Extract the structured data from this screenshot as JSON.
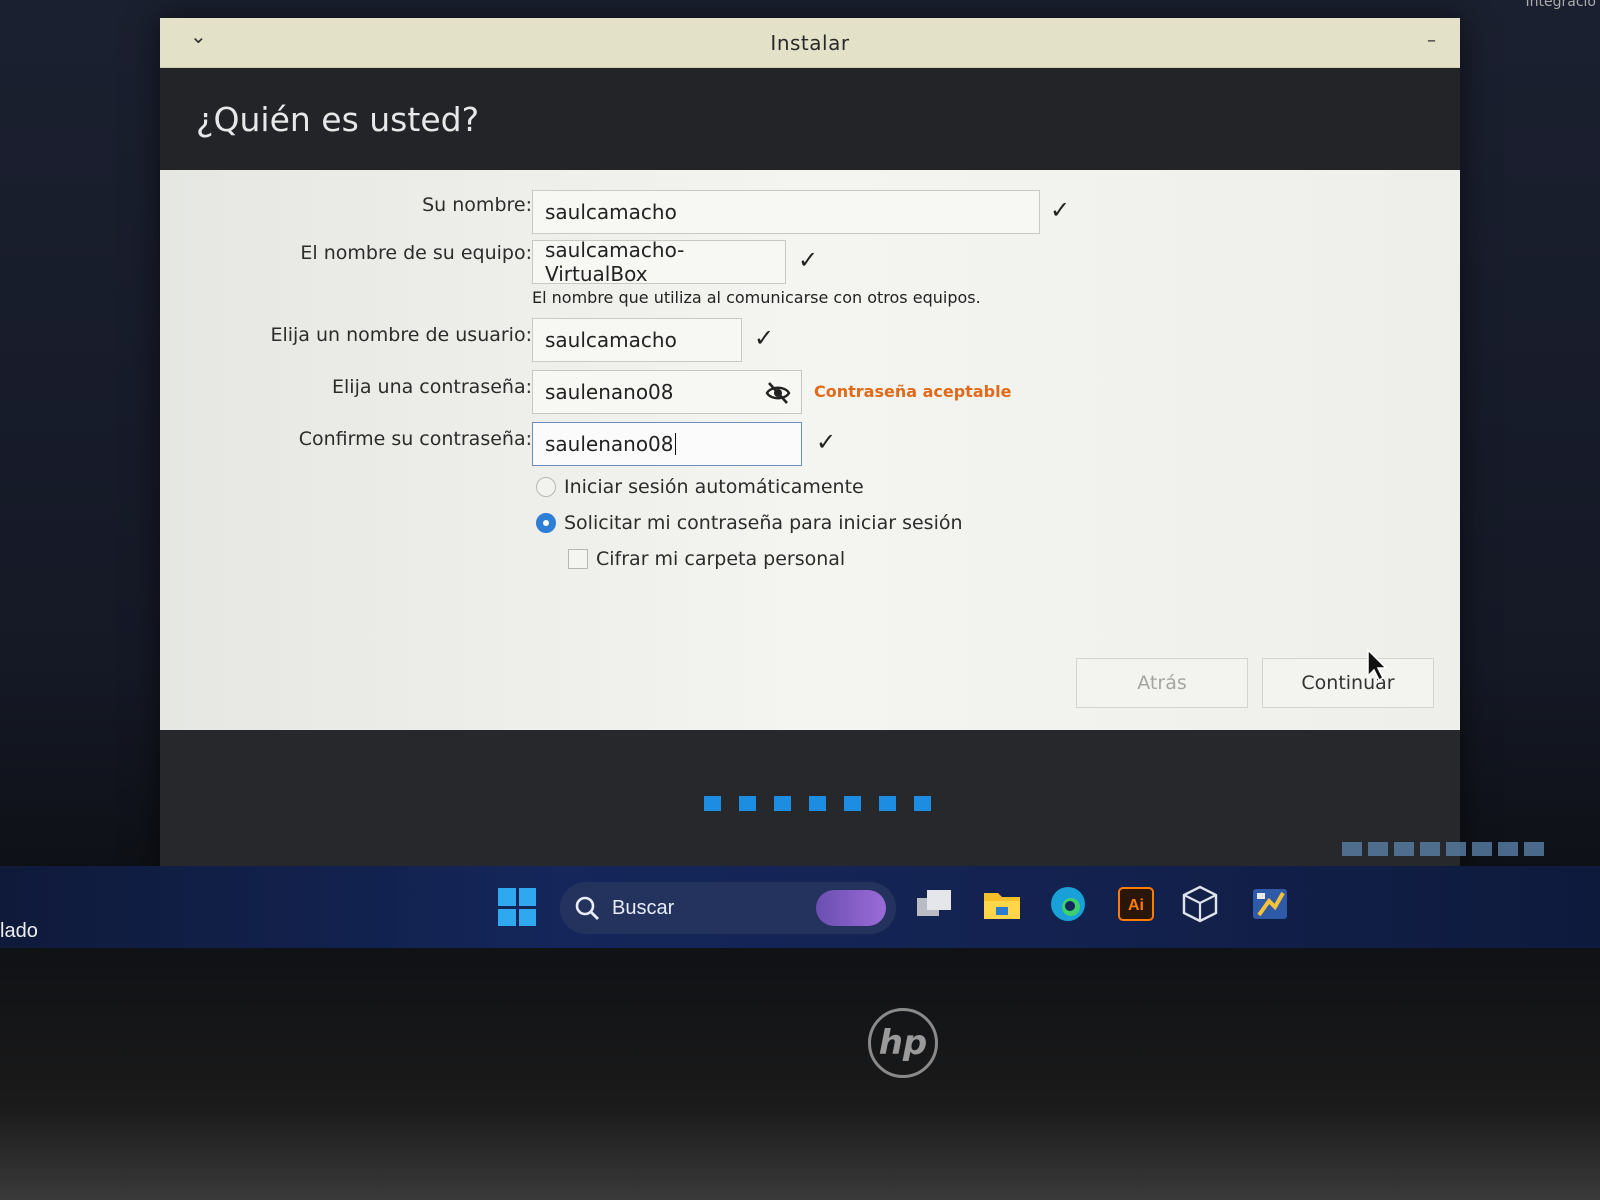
{
  "corner_text": "Integracio",
  "window": {
    "title": "Instalar",
    "heading": "¿Quién es usted?",
    "form": {
      "name_label": "Su nombre:",
      "name_value": "saulcamacho",
      "computer_label": "El nombre de su equipo:",
      "computer_value": "saulcamacho-VirtualBox",
      "computer_hint": "El nombre que utiliza al comunicarse con otros equipos.",
      "username_label": "Elija un nombre de usuario:",
      "username_value": "saulcamacho",
      "password_label": "Elija una contraseña:",
      "password_value": "saulenano08",
      "password_strength": "Contraseña aceptable",
      "confirm_label": "Confirme su contraseña:",
      "confirm_value": "saulenano08",
      "check_glyph": "✓"
    },
    "options": {
      "auto_login": "Iniciar sesión automáticamente",
      "require_password": "Solicitar mi contraseña para iniciar sesión",
      "encrypt_home": "Cifrar mi carpeta personal",
      "selected": "require_password",
      "encrypt_checked": false
    },
    "buttons": {
      "back": "Atrás",
      "next": "Continuar"
    },
    "progress": {
      "steps": 7,
      "accent": "#1c8de0"
    }
  },
  "taskbar": {
    "left_text": "lado",
    "search_label": "Buscar",
    "apps": [
      "task-view-icon",
      "file-explorer-icon",
      "edge-icon",
      "illustrator-icon",
      "virtualbox-icon",
      "virtualbox-manager-icon"
    ],
    "illustrator_text": "Ai"
  },
  "monitor": {
    "brand": "hp"
  }
}
